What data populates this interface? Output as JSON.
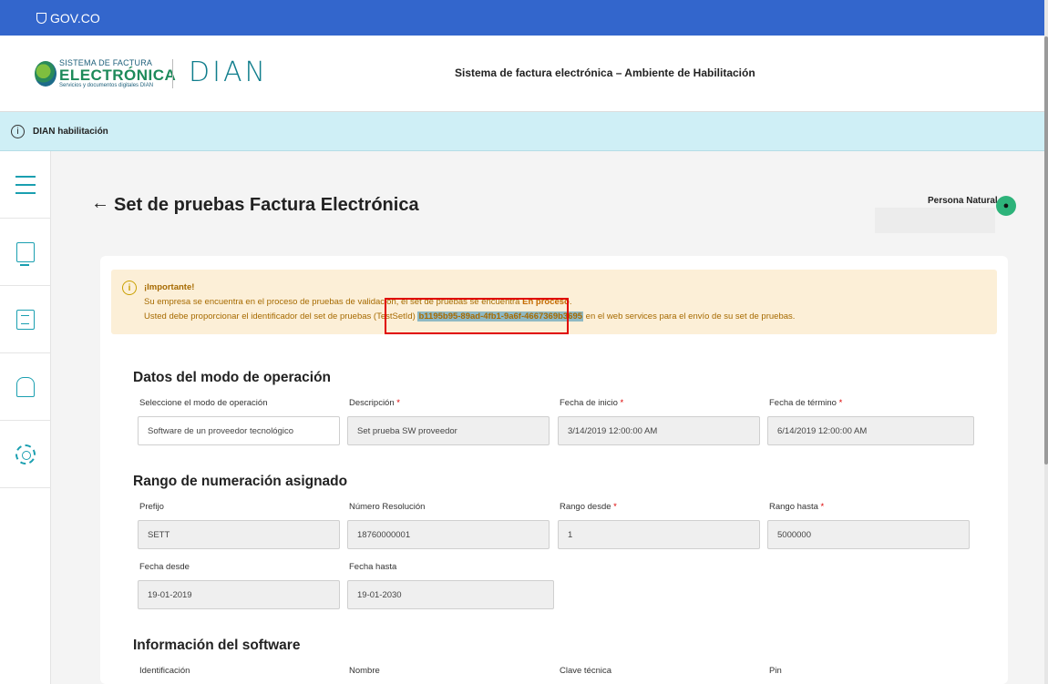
{
  "gov_bar": {
    "label": "GOV.CO"
  },
  "header": {
    "logo_line1": "SISTEMA DE FACTURA",
    "logo_line2": "ELECTRÓNICA",
    "logo_line3": "Servicios y documentos digitales DIAN",
    "dian_logo": "DIAN",
    "title": "Sistema de factura electrónica – Ambiente de Habilitación"
  },
  "info_bar": {
    "text": "DIAN habilitación"
  },
  "sidebar": {
    "items": [
      "menu-icon",
      "monitor-chart-icon",
      "document-icon",
      "person-board-icon",
      "gear-icon"
    ]
  },
  "page": {
    "title": "Set de pruebas Factura Electrónica",
    "back": "←"
  },
  "user": {
    "name": "Persona Natural"
  },
  "alert": {
    "title": "¡Importante!",
    "line1_a": "Su empresa se encuentra en el proceso de pruebas de validación, el set de pruebas se encuentra ",
    "line1_status": "En proceso",
    "line1_end": ".",
    "line2_a": "Usted debe proporcionar el identificador del set de pruebas (TestSetId) ",
    "test_set_id": "b1195b95-89ad-4fb1-9a6f-4667369b3695",
    "line2_b": " en el web services para el envío de su set de pruebas."
  },
  "sections": {
    "operation": {
      "title": "Datos del modo de operación",
      "mode_label": "Seleccione el modo de operación",
      "mode_value": "Software de un proveedor tecnológico",
      "desc_label": "Descripción",
      "desc_value": "Set prueba SW proveedor",
      "start_label": "Fecha de inicio",
      "start_value": "3/14/2019 12:00:00 AM",
      "end_label": "Fecha de término",
      "end_value": "6/14/2019 12:00:00 AM",
      "required_mark": "*"
    },
    "numbering": {
      "title": "Rango de numeración asignado",
      "prefix_label": "Prefijo",
      "prefix_value": "SETT",
      "resolution_label": "Número Resolución",
      "resolution_value": "18760000001",
      "from_label": "Rango desde",
      "from_value": "1",
      "to_label": "Rango hasta",
      "to_value": "5000000",
      "date_from_label": "Fecha desde",
      "date_from_value": "19-01-2019",
      "date_to_label": "Fecha hasta",
      "date_to_value": "19-01-2030",
      "required_mark": "*"
    },
    "software": {
      "title": "Información del software",
      "id_label": "Identificación",
      "name_label": "Nombre",
      "key_label": "Clave técnica",
      "pin_label": "Pin"
    }
  }
}
